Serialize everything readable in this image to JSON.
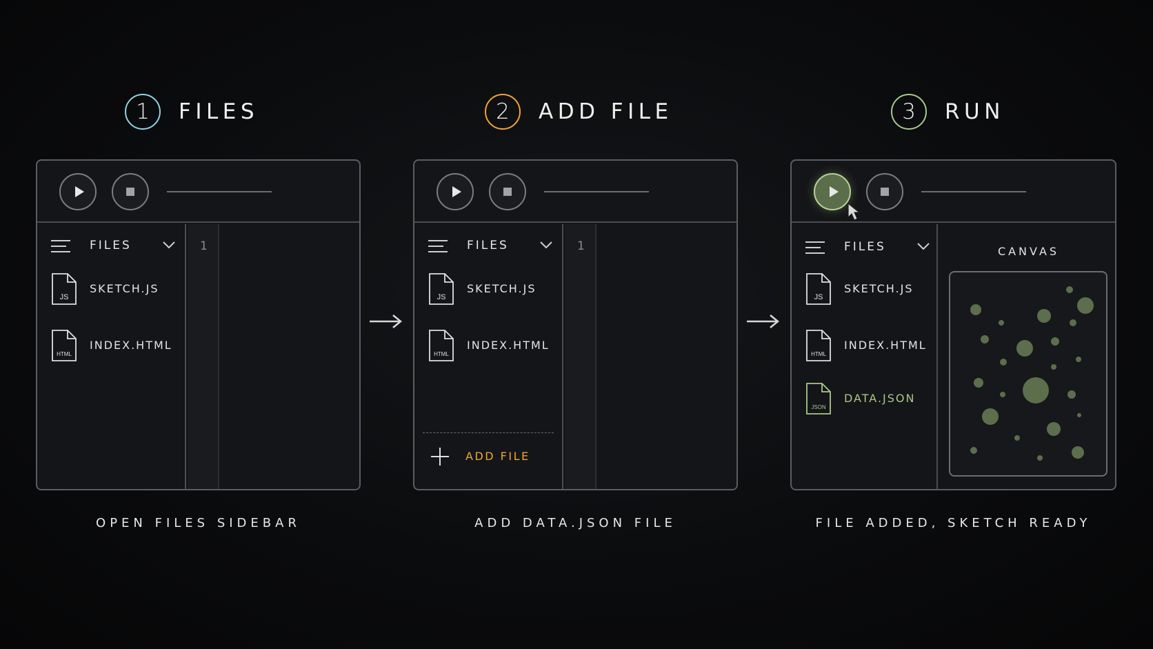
{
  "colors": {
    "step1": "#8fd3e6",
    "step2": "#f0a43a",
    "step3": "#a9c98a",
    "border": "#5a5d62",
    "panel_bg": "#141518",
    "accent_add": "#f0a43a",
    "accent_json": "#a9c98a",
    "dot": "#5c6e4c"
  },
  "steps": [
    {
      "number": "1",
      "title": "FILES",
      "caption": "OPEN FILES SIDEBAR",
      "sidebar_label": "FILES",
      "line_number": "1",
      "files": [
        {
          "name": "SKETCH.JS",
          "icon": "js-file-icon",
          "badge": "JS"
        },
        {
          "name": "INDEX.HTML",
          "icon": "html-file-icon",
          "badge": "HTML"
        }
      ]
    },
    {
      "number": "2",
      "title": "ADD FILE",
      "caption": "ADD DATA.JSON FILE",
      "sidebar_label": "FILES",
      "line_number": "1",
      "add_file_label": "ADD FILE",
      "files": [
        {
          "name": "SKETCH.JS",
          "icon": "js-file-icon",
          "badge": "JS"
        },
        {
          "name": "INDEX.HTML",
          "icon": "html-file-icon",
          "badge": "HTML"
        }
      ]
    },
    {
      "number": "3",
      "title": "RUN",
      "caption": "FILE ADDED, SKETCH READY",
      "sidebar_label": "FILES",
      "canvas_label": "CANVAS",
      "files": [
        {
          "name": "SKETCH.JS",
          "icon": "js-file-icon",
          "badge": "JS"
        },
        {
          "name": "INDEX.HTML",
          "icon": "html-file-icon",
          "badge": "HTML"
        },
        {
          "name": "DATA.JSON",
          "icon": "json-file-icon",
          "badge": "JSON"
        }
      ]
    }
  ]
}
